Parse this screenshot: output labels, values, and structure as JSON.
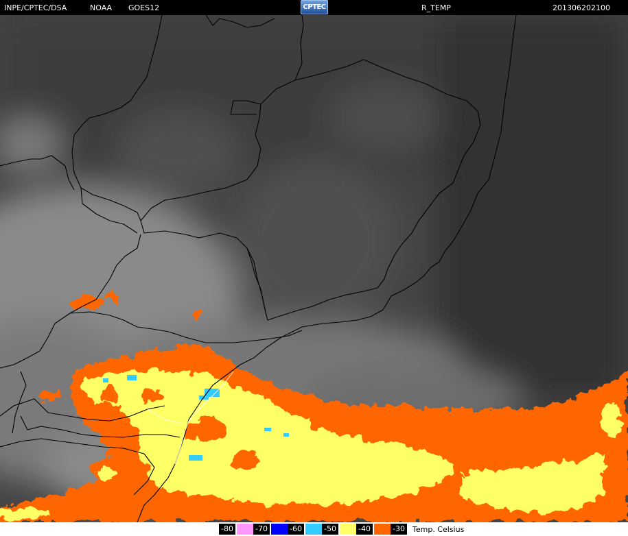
{
  "header": {
    "source": "INPE/CPTEC/DSA",
    "agency": "NOAA",
    "satellite": "GOES12",
    "logo_text": "CPTEC",
    "product": "R_TEMP",
    "timestamp": "201306202100"
  },
  "legend": {
    "items": [
      {
        "label": "-80",
        "color": "#ff99ff"
      },
      {
        "label": "-70",
        "color": "#0000ff"
      },
      {
        "label": "-60",
        "color": "#33ccff"
      },
      {
        "label": "-50",
        "color": "#ffff66"
      },
      {
        "label": "-40",
        "color": "#ff6600"
      },
      {
        "label": "-30",
        "color": "#ffffff"
      }
    ],
    "unit": "Temp. Celsius"
  },
  "colors": {
    "background_cloud": "#3c3c3c",
    "border_line": "#000000"
  }
}
